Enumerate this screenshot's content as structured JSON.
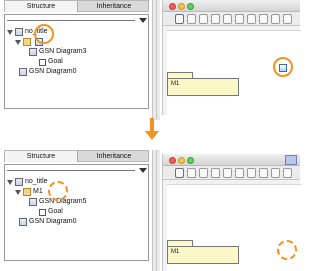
{
  "top": {
    "tabs": [
      "Structure",
      "Inheritance"
    ],
    "tree": {
      "root": "no_title",
      "folder": "",
      "items": [
        "GSN Diagram3",
        "Goal",
        "GSN Diagram0"
      ]
    },
    "node_label": "M1"
  },
  "bottom": {
    "tabs": [
      "Structure",
      "Inheritance"
    ],
    "tree": {
      "root": "no_title",
      "folder": "M1",
      "items": [
        "GSN Diagram5",
        "Goal",
        "GSN Diagram0"
      ]
    },
    "node_label": "M1"
  },
  "colors": {
    "highlight": "#f39222",
    "node_fill": "#fbf8c8"
  },
  "icons": [
    "pointer-icon",
    "new-diagram-icon",
    "close-button-icon",
    "minimize-button-icon",
    "zoom-button-icon",
    "arrow-down-icon"
  ]
}
